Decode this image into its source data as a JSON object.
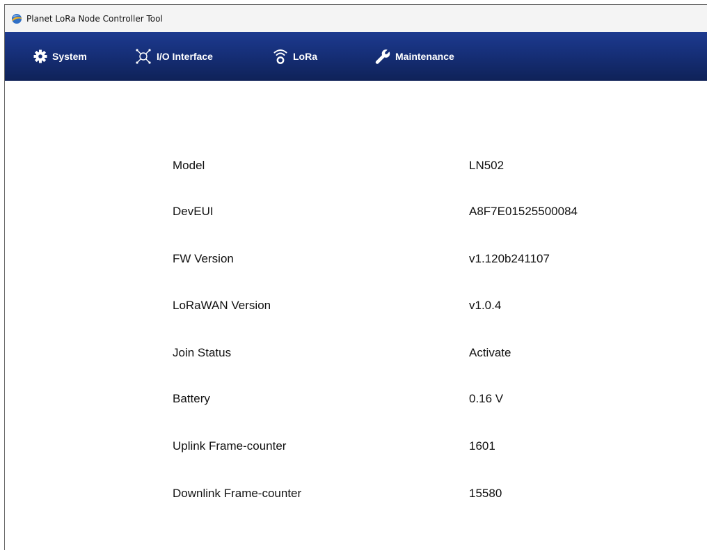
{
  "window": {
    "title": "Planet LoRa Node Controller Tool"
  },
  "nav": {
    "items": [
      {
        "label": "System",
        "icon": "gear-icon"
      },
      {
        "label": "I/O Interface",
        "icon": "io-interface-icon"
      },
      {
        "label": "LoRa",
        "icon": "wireless-icon"
      },
      {
        "label": "Maintenance",
        "icon": "wrench-icon"
      }
    ]
  },
  "info": {
    "rows": [
      {
        "label": "Model",
        "value": "LN502"
      },
      {
        "label": "DevEUI",
        "value": "A8F7E01525500084"
      },
      {
        "label": "FW Version",
        "value": "v1.120b241107"
      },
      {
        "label": "LoRaWAN Version",
        "value": "v1.0.4"
      },
      {
        "label": "Join Status",
        "value": "Activate"
      },
      {
        "label": "Battery",
        "value": "0.16 V"
      },
      {
        "label": "Uplink Frame-counter",
        "value": "1601"
      },
      {
        "label": "Downlink Frame-counter",
        "value": "15580"
      }
    ]
  },
  "colors": {
    "navbar_top": "#1d3a8f",
    "navbar_bottom": "#0f2258",
    "titlebar": "#f4f4f4",
    "text": "#111111"
  }
}
